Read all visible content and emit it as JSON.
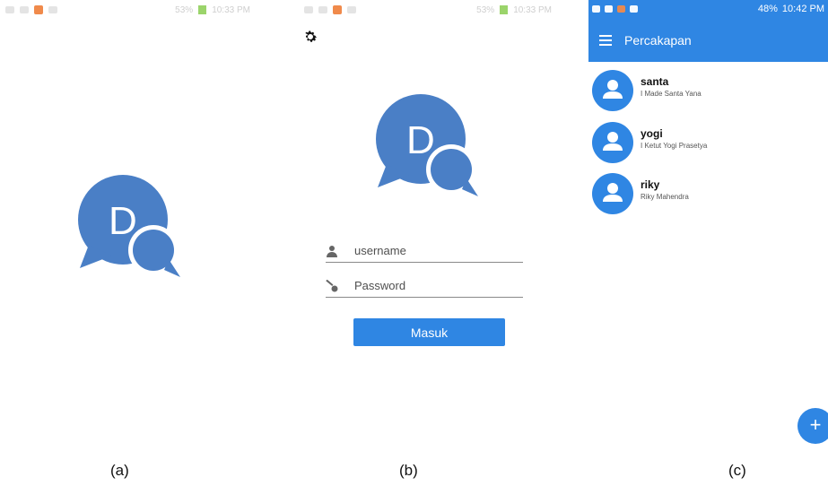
{
  "panel_a": {
    "status": {
      "time": "10:33 PM",
      "battery": "53%"
    },
    "logo_letter": "D"
  },
  "panel_b": {
    "status": {
      "time": "10:33 PM",
      "battery": "53%"
    },
    "logo_letter": "D",
    "username_placeholder": "username",
    "password_placeholder": "Password",
    "login_button": "Masuk"
  },
  "panel_c": {
    "status": {
      "time": "10:42 PM",
      "battery": "48%"
    },
    "title": "Percakapan",
    "contacts": [
      {
        "username": "santa",
        "full_name": "I Made Santa Yana"
      },
      {
        "username": "yogi",
        "full_name": "I Ketut Yogi Prasetya"
      },
      {
        "username": "riky",
        "full_name": "Riky Mahendra"
      }
    ],
    "fab_symbol": "+"
  },
  "captions": [
    "(a)",
    "(b)",
    "(c)"
  ],
  "colors": {
    "accent": "#2f86e3",
    "logo_blue": "#4a7fc6"
  }
}
